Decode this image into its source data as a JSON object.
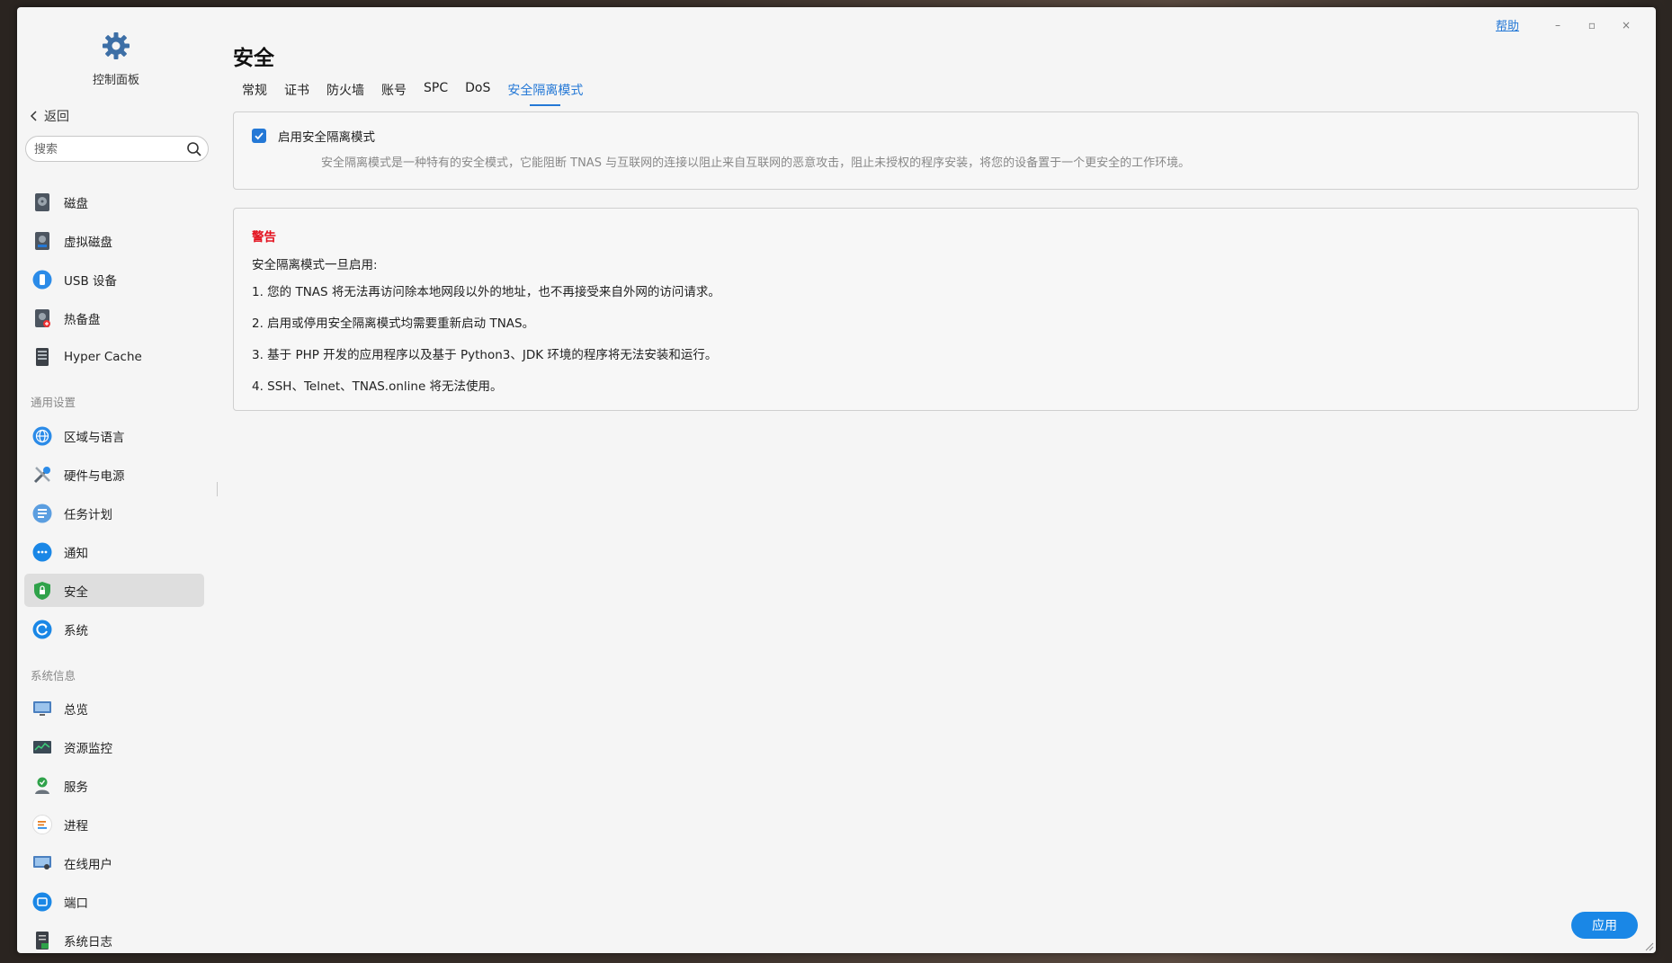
{
  "window": {
    "help": "帮助",
    "minimize": "–",
    "maximize": "▫",
    "close": "×"
  },
  "sidebar": {
    "app_title": "控制面板",
    "back_label": "返回",
    "search_placeholder": "搜索",
    "group1": [
      {
        "label": "磁盘",
        "icon": "disk-icon"
      },
      {
        "label": "虚拟磁盘",
        "icon": "virtual-disk-icon"
      },
      {
        "label": "USB 设备",
        "icon": "usb-icon"
      },
      {
        "label": "热备盘",
        "icon": "hot-spare-icon"
      },
      {
        "label": "Hyper Cache",
        "icon": "hyper-cache-icon"
      }
    ],
    "section_general": "通用设置",
    "group2": [
      {
        "label": "区域与语言",
        "icon": "globe-icon"
      },
      {
        "label": "硬件与电源",
        "icon": "tools-icon"
      },
      {
        "label": "任务计划",
        "icon": "task-list-icon"
      },
      {
        "label": "通知",
        "icon": "chat-bubble-icon"
      },
      {
        "label": "安全",
        "icon": "shield-lock-icon"
      },
      {
        "label": "系统",
        "icon": "system-refresh-icon"
      }
    ],
    "section_info": "系统信息",
    "group3": [
      {
        "label": "总览",
        "icon": "monitor-icon"
      },
      {
        "label": "资源监控",
        "icon": "resource-chart-icon"
      },
      {
        "label": "服务",
        "icon": "service-icon"
      },
      {
        "label": "进程",
        "icon": "process-list-icon"
      },
      {
        "label": "在线用户",
        "icon": "online-users-icon"
      },
      {
        "label": "端口",
        "icon": "port-icon"
      },
      {
        "label": "系统日志",
        "icon": "log-icon"
      }
    ]
  },
  "main": {
    "title": "安全",
    "tabs": [
      "常规",
      "证书",
      "防火墙",
      "账号",
      "SPC",
      "DoS",
      "安全隔离模式"
    ],
    "active_tab": "安全隔离模式",
    "isolation": {
      "checkbox_label": "启用安全隔离模式",
      "checked": true,
      "description": "安全隔离模式是一种特有的安全模式，它能阻断 TNAS 与互联网的连接以阻止来自互联网的恶意攻击，阻止未授权的程序安装，将您的设备置于一个更安全的工作环境。"
    },
    "warning": {
      "title": "警告",
      "intro": "安全隔离模式一旦启用:",
      "items": [
        "1. 您的 TNAS 将无法再访问除本地网段以外的地址，也不再接受来自外网的访问请求。",
        "2. 启用或停用安全隔离模式均需要重新启动 TNAS。",
        "3. 基于 PHP 开发的应用程序以及基于 Python3、JDK 环境的程序将无法安装和运行。",
        "4. SSH、Telnet、TNAS.online 将无法使用。"
      ]
    },
    "apply_label": "应用"
  },
  "colors": {
    "accent": "#2478d6",
    "warning": "#e3111e",
    "active_nav": "#dedede"
  }
}
